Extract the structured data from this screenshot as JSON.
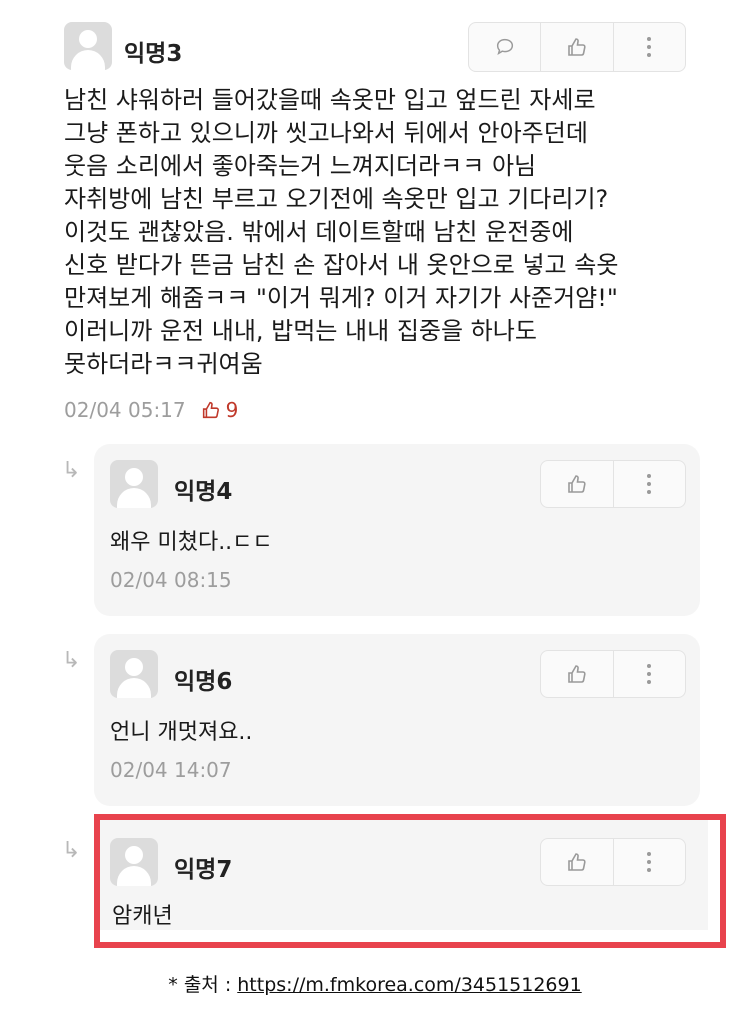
{
  "main_comment": {
    "author": "익명3",
    "lines": [
      "남친 샤워하러 들어갔을때 속옷만 입고 엎드린 자세로",
      "그냥 폰하고 있으니까 씻고나와서 뒤에서 안아주던데",
      "웃음 소리에서 좋아죽는거 느껴지더라ㅋㅋ 아님",
      "자취방에 남친 부르고 오기전에 속옷만 입고 기다리기?",
      "이것도 괜찮았음. 밖에서 데이트할때 남친 운전중에",
      "신호 받다가 뜬금 남친 손 잡아서 내 옷안으로 넣고 속옷",
      "만져보게 해줌ㅋㅋ \"이거 뭐게? 이거 자기가 사준거얌!\"",
      "이러니까 운전 내내, 밥먹는 내내 집중을 하나도",
      "못하더라ㅋㅋ귀여움"
    ],
    "timestamp": "02/04 05:17",
    "likes": "9",
    "icons": [
      "avatar-icon",
      "reply-icon",
      "thumbs-up-icon",
      "more-icon"
    ]
  },
  "replies": [
    {
      "author": "익명4",
      "text": "왜우 미쳤다..ㄷㄷ",
      "timestamp": "02/04 08:15"
    },
    {
      "author": "익명6",
      "text": "언니 개멋져요..",
      "timestamp": "02/04 14:07"
    },
    {
      "author": "익명7",
      "text": "암캐년"
    }
  ],
  "reply_arrow": "↳",
  "source": {
    "prefix": "* 출처 : ",
    "url": "https://m.fmkorea.com/3451512691"
  },
  "colors": {
    "highlight_border": "#e8434d",
    "like_red": "#c0392b",
    "reply_bg": "#f5f5f5"
  }
}
